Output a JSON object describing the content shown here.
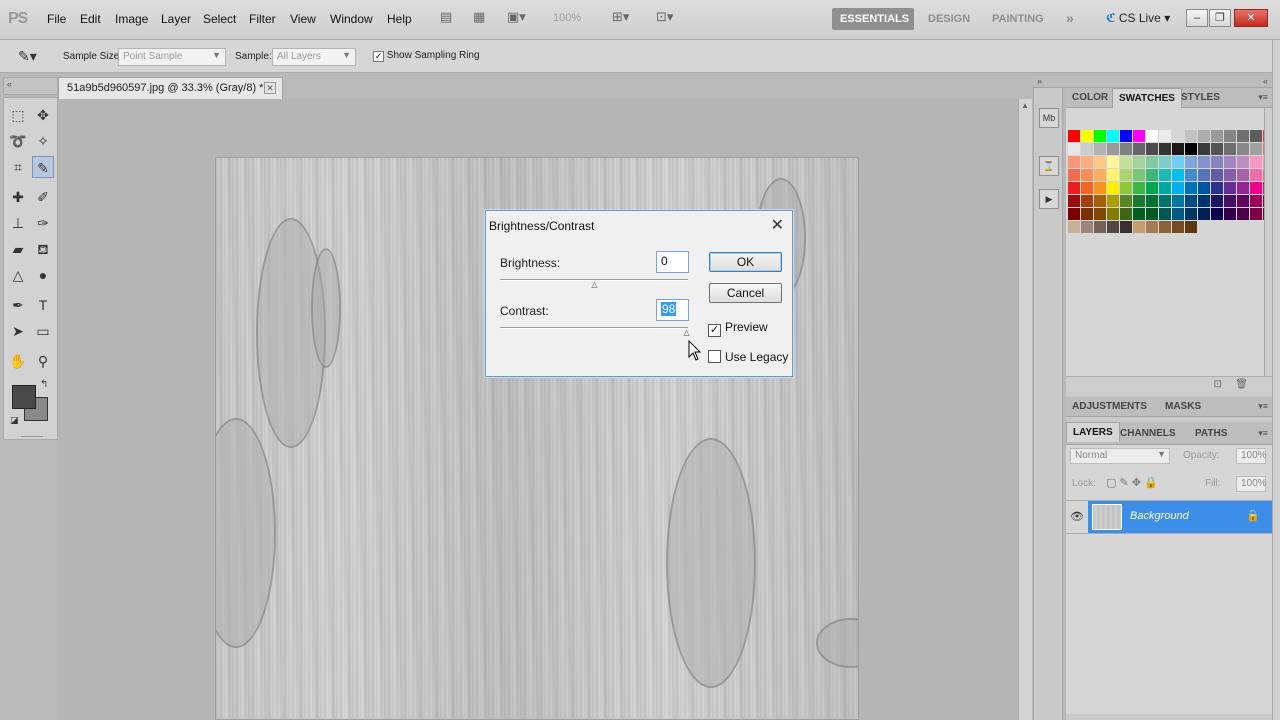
{
  "app": {
    "logo": "PS"
  },
  "menu": [
    "File",
    "Edit",
    "Image",
    "Layer",
    "Select",
    "Filter",
    "View",
    "Window",
    "Help"
  ],
  "menubar": {
    "zoom": "100%",
    "workspaces": [
      "ESSENTIALS",
      "DESIGN",
      "PAINTING"
    ],
    "more": "»",
    "cs_live": "CS Live"
  },
  "options": {
    "sample_size_label": "Sample Size:",
    "sample_size_value": "Point Sample",
    "sample_label": "Sample:",
    "sample_value": "All Layers",
    "show_ring_label": "Show Sampling Ring",
    "show_ring_checked": true
  },
  "document": {
    "tab_title": "51a9b5d960597.jpg @ 33.3% (Gray/8) *"
  },
  "dialog": {
    "title": "Brightness/Contrast",
    "brightness_label": "Brightness:",
    "brightness_value": "0",
    "contrast_label": "Contrast:",
    "contrast_value": "98",
    "ok_label": "OK",
    "cancel_label": "Cancel",
    "preview_label": "Preview",
    "preview_checked": true,
    "legacy_label": "Use Legacy",
    "legacy_checked": false,
    "brightness_slider_fraction": 0.5,
    "contrast_slider_fraction": 0.99
  },
  "panels": {
    "top_tabs": [
      "COLOR",
      "SWATCHES",
      "STYLES"
    ],
    "top_active": "SWATCHES",
    "mid_tabs": [
      "ADJUSTMENTS",
      "MASKS"
    ],
    "layer_tabs": [
      "LAYERS",
      "CHANNELS",
      "PATHS"
    ],
    "layer_active": "LAYERS",
    "blend_mode": "Normal",
    "opacity_label": "Opacity:",
    "opacity_value": "100%",
    "lock_label": "Lock:",
    "fill_label": "Fill:",
    "fill_value": "100%",
    "layer_name": "Background"
  },
  "colors": {
    "accent": "#3d8ee8",
    "dialog_border": "#6e97c4",
    "essentials_bg": "#8f8f8f"
  },
  "swatches": [
    "#ff0000",
    "#ffff00",
    "#00ff00",
    "#00ffff",
    "#0000ff",
    "#ff00ff",
    "#ffffff",
    "#ebebeb",
    "#d6d6d6",
    "#c2c2c2",
    "#adadad",
    "#999999",
    "#858585",
    "#707070",
    "#5c5c5c",
    "#ff3333",
    "#e6e6e6",
    "#cccccc",
    "#b3b3b3",
    "#9a9a9a",
    "#808080",
    "#666666",
    "#4d4d4d",
    "#333333",
    "#1a1a1a",
    "#000000",
    "#3a3a3a",
    "#545454",
    "#6e6e6e",
    "#888888",
    "#a1a1a1",
    "#ff6666",
    "#f7977a",
    "#fbad82",
    "#fdc68c",
    "#fff799",
    "#c4df9b",
    "#a3d39c",
    "#82ca9d",
    "#7bcdc8",
    "#6ecff6",
    "#7ea7d8",
    "#8493ca",
    "#8882be",
    "#a187be",
    "#bc8dbf",
    "#f49ac2",
    "#f6989d",
    "#f26c4f",
    "#f68e56",
    "#fbaf5c",
    "#fff467",
    "#acd372",
    "#7cc576",
    "#3bb878",
    "#1abbb4",
    "#00bff3",
    "#438ccb",
    "#5574b9",
    "#605ca8",
    "#855fa8",
    "#a763a8",
    "#f06ea9",
    "#f26d7d",
    "#ed1c24",
    "#f26522",
    "#f7941d",
    "#fff200",
    "#8dc73f",
    "#39b54a",
    "#00a651",
    "#00a99d",
    "#00aeef",
    "#0072bc",
    "#0054a6",
    "#2e3192",
    "#662d91",
    "#92278f",
    "#ec008c",
    "#ed145b",
    "#9e0b0f",
    "#a0410d",
    "#a36209",
    "#aba000",
    "#598527",
    "#1a7b30",
    "#007236",
    "#00746b",
    "#0076a3",
    "#004b80",
    "#003471",
    "#1b1464",
    "#440e62",
    "#630460",
    "#9e005d",
    "#9e0039",
    "#790000",
    "#7b2e00",
    "#7d4900",
    "#827b00",
    "#406618",
    "#005e20",
    "#005826",
    "#005952",
    "#005b7f",
    "#003663",
    "#002157",
    "#0d004c",
    "#32004b",
    "#4b0049",
    "#7b0046",
    "#7a0026",
    "#c7b299",
    "#998675",
    "#736357",
    "#534741",
    "#37302d",
    "#c69c6d",
    "#a67c52",
    "#8c6239",
    "#754c24",
    "#603913"
  ]
}
